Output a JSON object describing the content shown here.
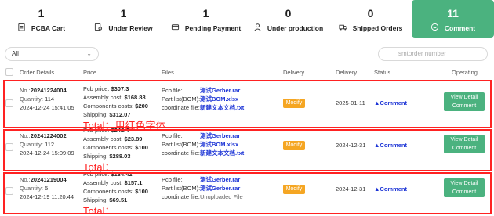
{
  "tabs": [
    {
      "count": "1",
      "label": "PCBA Cart",
      "icon": "clipboard-icon",
      "active": false
    },
    {
      "count": "1",
      "label": "Under Review",
      "icon": "review-icon",
      "active": false
    },
    {
      "count": "1",
      "label": "Pending Payment",
      "icon": "payment-icon",
      "active": false
    },
    {
      "count": "0",
      "label": "Under production",
      "icon": "worker-icon",
      "active": false
    },
    {
      "count": "0",
      "label": "Shipped Orders",
      "icon": "truck-icon",
      "active": false
    },
    {
      "count": "11",
      "label": "Comment",
      "icon": "comment-icon",
      "active": true
    }
  ],
  "filter": {
    "value": "All"
  },
  "search": {
    "placeholder": "smtorder number"
  },
  "columns": {
    "order_details": "Order Details",
    "price": "Price",
    "files": "Files",
    "delivery1": "Delivery",
    "delivery2": "Delivery",
    "status": "Status",
    "operating": "Operating"
  },
  "orders": [
    {
      "no_label": "No.:",
      "no": "20241224004",
      "quantity_label": "Quantity:",
      "quantity": "114",
      "datetime": "2024-12-24 15:41:05",
      "pcb_label": "Pcb price:",
      "pcb": "$307.3",
      "assembly_label": "Assembly cost:",
      "assembly": "$168.88",
      "components_label": "Components costs:",
      "components": "$200",
      "shipping_label": "Shipping:",
      "shipping": "$312.07",
      "pcbfile_label": "Pcb file:",
      "pcbfile": "测试Gerber.rar",
      "bom_label": "Part list(BOM):",
      "bom": "测试BOM.xlsx",
      "coord_label": "coordinate file:",
      "coord": "新建文本文档.txt",
      "modify": "Modify",
      "delivery": "2025-01-11",
      "status": "▲Comment",
      "view_line1": "View Detail",
      "view_line2": "Comment",
      "total_note": "Total：用红色字体"
    },
    {
      "no_label": "No.:",
      "no": "20241224002",
      "quantity_label": "Quantity:",
      "quantity": "112",
      "datetime": "2024-12-24 15:09:09",
      "pcb_label": "Pcb price:",
      "pcb": "$242.4",
      "assembly_label": "Assembly cost:",
      "assembly": "$23.89",
      "components_label": "Components costs:",
      "components": "$100",
      "shipping_label": "Shipping:",
      "shipping": "$288.03",
      "pcbfile_label": "Pcb file:",
      "pcbfile": "测试Gerber.rar",
      "bom_label": "Part list(BOM):",
      "bom": "测试BOM.xlsx",
      "coord_label": "coordinate file:",
      "coord": "新建文本文档.txt",
      "modify": "Modify",
      "delivery": "2024-12-31",
      "status": "▲Comment",
      "view_line1": "View Detail",
      "view_line2": "Comment",
      "total_note": "Total："
    },
    {
      "no_label": "No.:",
      "no": "20241219004",
      "quantity_label": "Quantity:",
      "quantity": "5",
      "datetime": "2024-12-19 11:20:44",
      "pcb_label": "Pcb price:",
      "pcb": "$134.42",
      "assembly_label": "Assembly cost:",
      "assembly": "$157.1",
      "components_label": "Components costs:",
      "components": "$100",
      "shipping_label": "Shipping:",
      "shipping": "$69.51",
      "pcbfile_label": "Pcb file:",
      "pcbfile": "测试Gerber.rar",
      "bom_label": "Part list(BOM):",
      "bom": "测试Gerber.rar",
      "coord_label": "coordinate file:",
      "coord": "Unuploaded File",
      "modify": "Modify",
      "delivery": "2024-12-31",
      "status": "▲Comment",
      "view_line1": "View Detail",
      "view_line2": "Comment",
      "total_note": "Total："
    }
  ],
  "colors": {
    "accent": "#4bb27f",
    "modify": "#f5a623",
    "link": "#1d35d6",
    "highlight": "#ff2222"
  }
}
